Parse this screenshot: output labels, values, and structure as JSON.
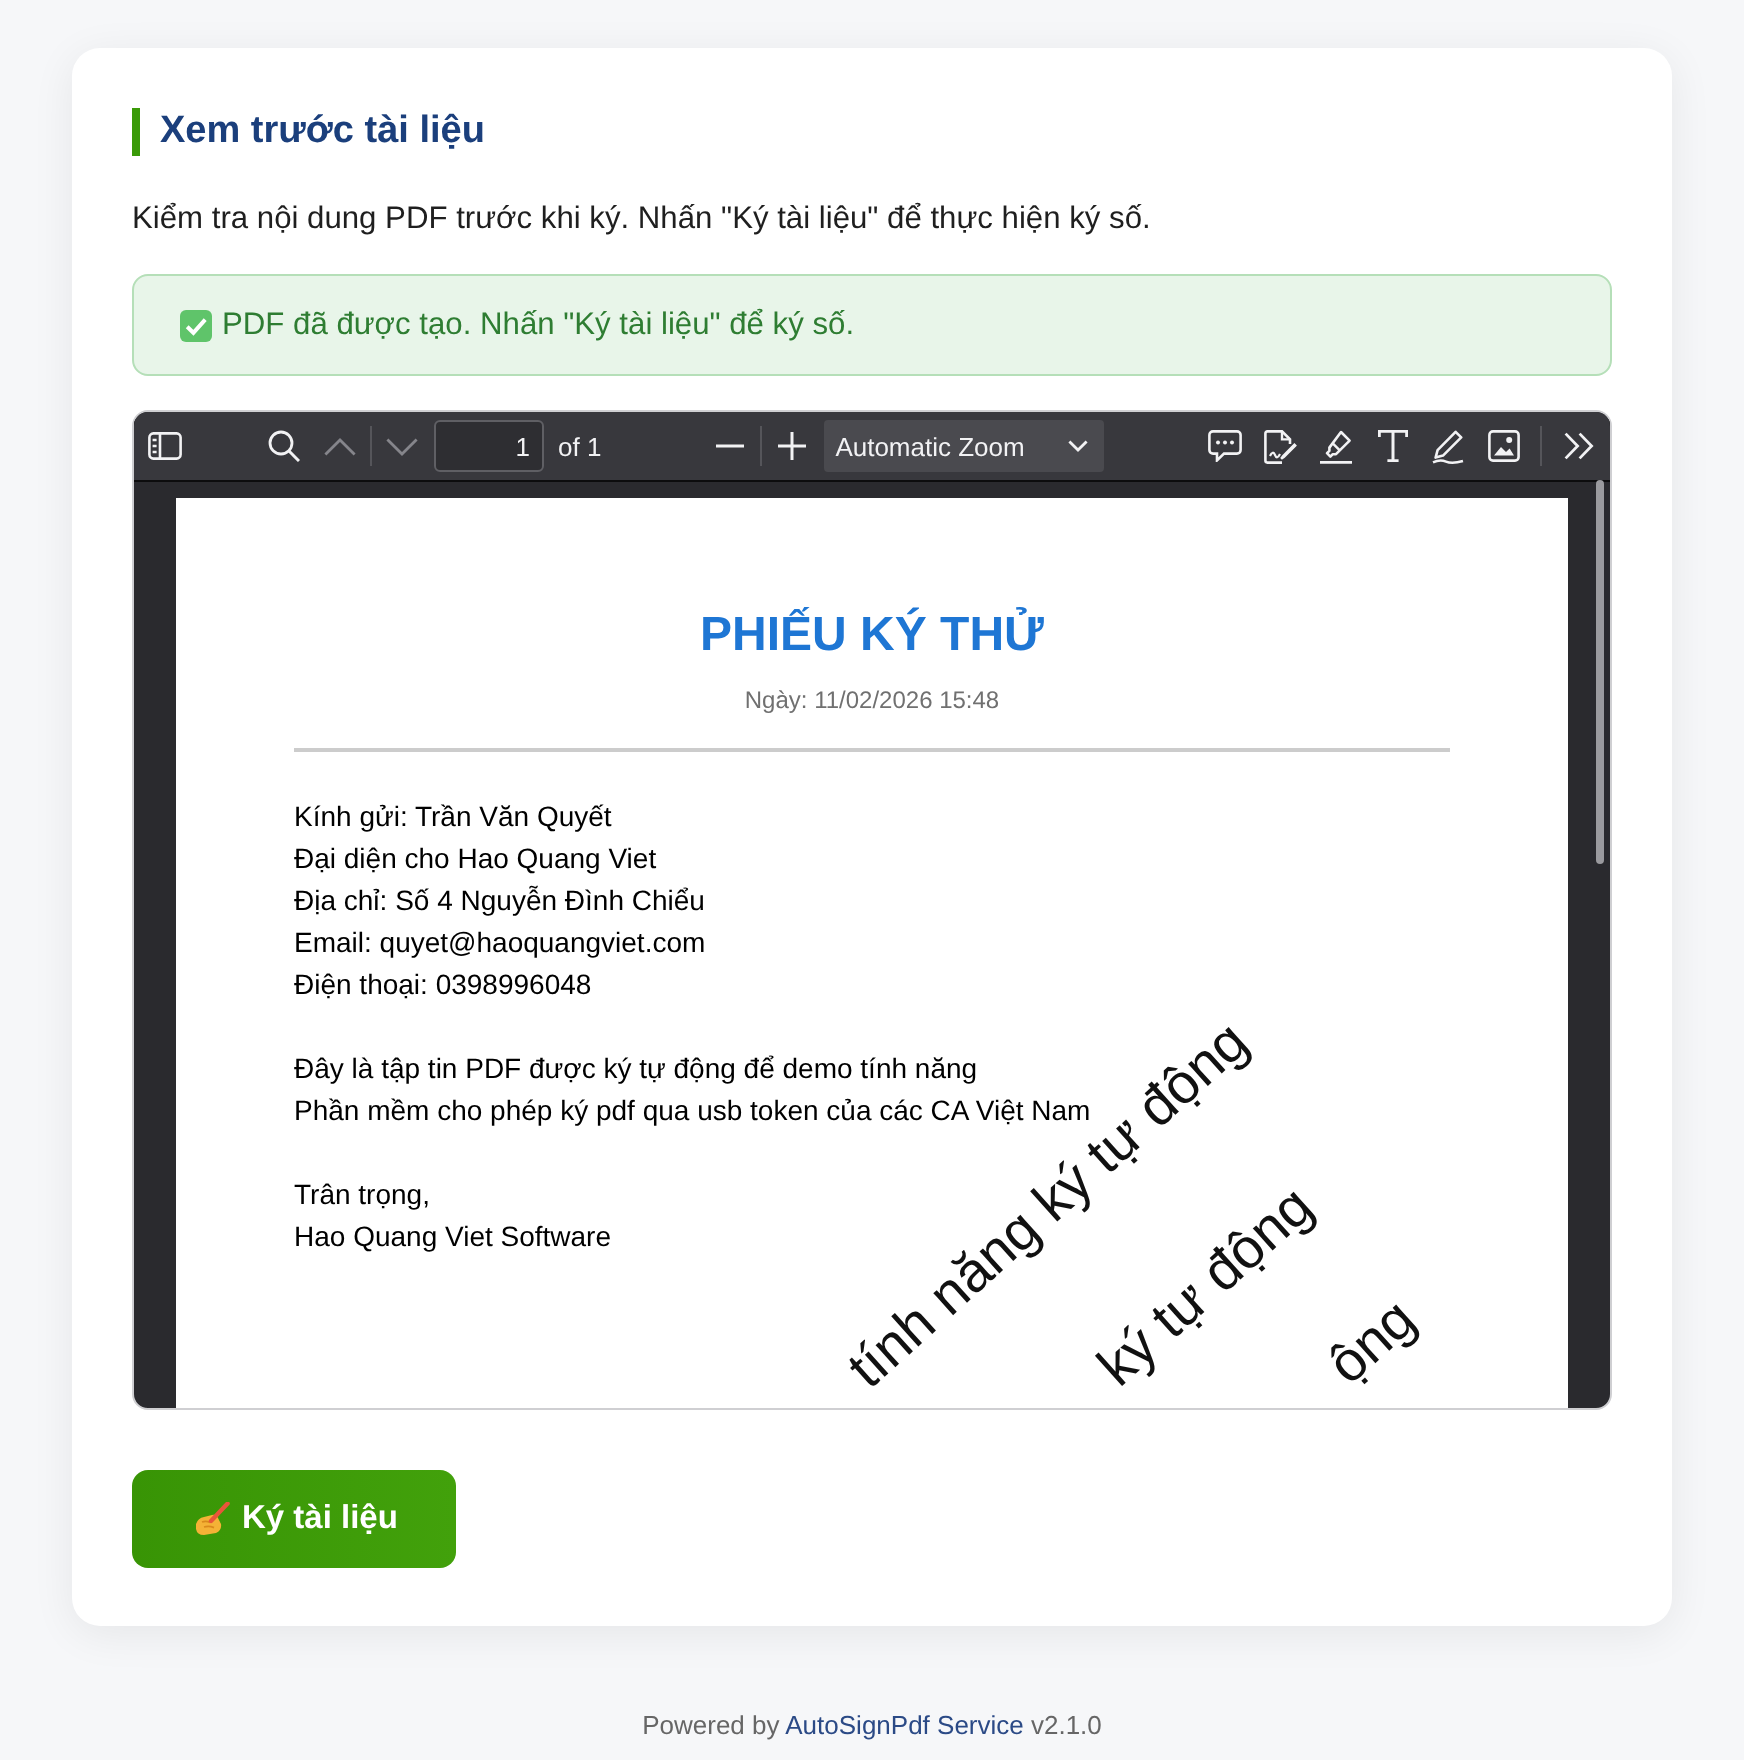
{
  "card": {
    "title": "Xem trước tài liệu",
    "description": "Kiểm tra nội dung PDF trước khi ký. Nhấn \"Ký tài liệu\" để thực hiện ký số.",
    "alert": {
      "kind": "success",
      "text": "PDF đã được tạo. Nhấn \"Ký tài liệu\" để ký số."
    }
  },
  "pdf_viewer": {
    "toolbar": {
      "view_buttons": [
        {
          "kind": "sidebar",
          "disabled": false
        }
      ],
      "find_buttons": [
        {
          "kind": "search",
          "disabled": false
        },
        {
          "kind": "previous",
          "disabled": true
        },
        {
          "kind": "next",
          "disabled": true
        }
      ],
      "page_number": {
        "value": "1"
      },
      "page_count": "of 1",
      "zoom_buttons": [
        {
          "kind": "zoom-out",
          "disabled": false
        },
        {
          "kind": "zoom-in",
          "disabled": false
        }
      ],
      "zoom_select": {
        "value": "Automatic Zoom"
      },
      "editor_buttons": [
        {
          "kind": "comment",
          "disabled": false
        },
        {
          "kind": "signature",
          "disabled": false
        },
        {
          "kind": "highlight",
          "disabled": false
        },
        {
          "kind": "text",
          "disabled": false
        },
        {
          "kind": "draw",
          "disabled": false
        },
        {
          "kind": "image",
          "disabled": false
        }
      ],
      "more_buttons": [
        {
          "kind": "more",
          "disabled": false
        }
      ]
    },
    "document": {
      "title": "PHIẾU KÝ THỬ",
      "date": "Ngày: 11/02/2026 15:48",
      "paragraphs": [
        [
          "Kính gửi: Trần Văn Quyết",
          "Đại diện cho Hao Quang Viet",
          "Địa chỉ: Số 4 Nguyễn Đình Chiểu",
          "Email: quyet@haoquangviet.com",
          "Điện thoại: 0398996048"
        ],
        [
          "Đây là tập tin PDF được ký tự động để demo tính năng",
          "Phần mềm cho phép ký pdf qua usb token của các CA Việt Nam"
        ],
        [
          "Trân trọng,",
          "Hao Quang Viet Software"
        ]
      ],
      "watermarks": [
        "tính năng ký tự động",
        "ký tự động",
        "ộng"
      ]
    }
  },
  "sign_button": {
    "label": "Ký tài liệu"
  },
  "footer": {
    "prefix": "Powered by",
    "link": "AutoSignPdf Service",
    "version": "v2.1.0"
  }
}
